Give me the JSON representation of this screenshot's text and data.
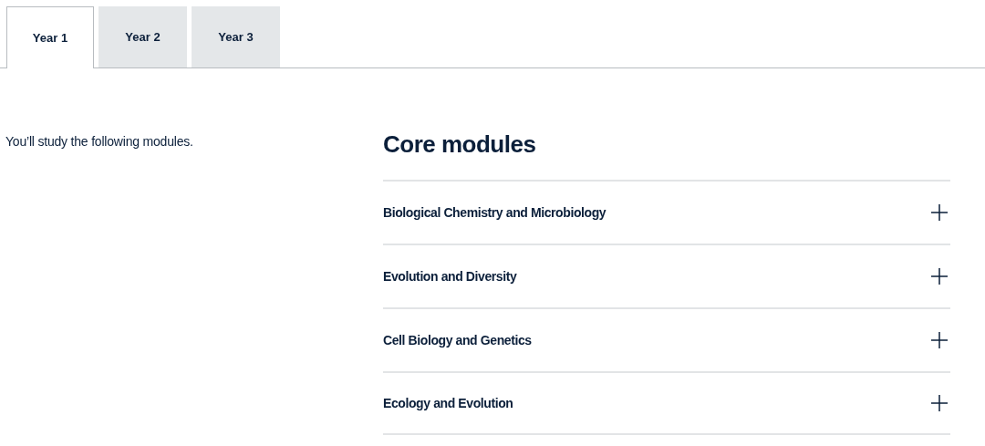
{
  "tabs": [
    {
      "label": "Year 1",
      "selected": true
    },
    {
      "label": "Year 2",
      "selected": false
    },
    {
      "label": "Year 3",
      "selected": false
    }
  ],
  "intro": "You’ll study the following modules.",
  "section_title": "Core modules",
  "modules": [
    {
      "title": "Biological Chemistry and Microbiology",
      "expanded": false
    },
    {
      "title": "Evolution and Diversity",
      "expanded": false
    },
    {
      "title": "Cell Biology and Genetics",
      "expanded": false
    },
    {
      "title": "Ecology and Evolution",
      "expanded": false
    }
  ]
}
